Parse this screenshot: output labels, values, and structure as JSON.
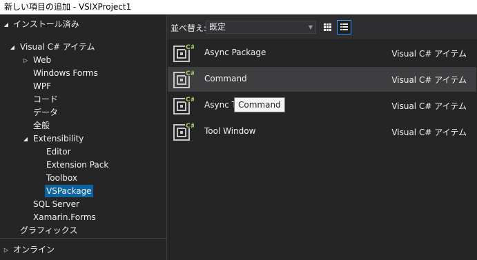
{
  "window": {
    "title": "新しい項目の追加 - VSIXProject1"
  },
  "tree": {
    "installed": "インストール済み",
    "visual_cs": "Visual C# アイテム",
    "web": "Web",
    "windows_forms": "Windows Forms",
    "wpf": "WPF",
    "code": "コード",
    "data": "データ",
    "general": "全般",
    "extensibility": "Extensibility",
    "editor": "Editor",
    "extension_pack": "Extension Pack",
    "toolbox": "Toolbox",
    "vspackage": "VSPackage",
    "sql_server": "SQL Server",
    "xamarin_forms": "Xamarin.Forms",
    "graphics": "グラフィックス",
    "online": "オンライン"
  },
  "toolbar": {
    "sort_label": "並べ替え:",
    "sort_value": "既定"
  },
  "templates": [
    {
      "name": "Async Package",
      "type": "Visual C# アイテム"
    },
    {
      "name": "Command",
      "type": "Visual C# アイテム"
    },
    {
      "name": "Async Tool Window",
      "type": "Visual C# アイテム"
    },
    {
      "name": "Tool Window",
      "type": "Visual C# アイテム"
    }
  ],
  "tooltip": {
    "text": "Command"
  },
  "icons": {
    "expanded": "triangle-expanded-icon",
    "collapsed": "triangle-collapsed-icon",
    "grid_view": "grid-view-icon",
    "list_view": "list-view-icon",
    "template": "csharp-item-template-icon"
  },
  "colors": {
    "selection": "#0e639c",
    "hover_row": "#3e3e40",
    "active_view_border": "#3399ff",
    "icon_badge": "#9fcf5f"
  }
}
